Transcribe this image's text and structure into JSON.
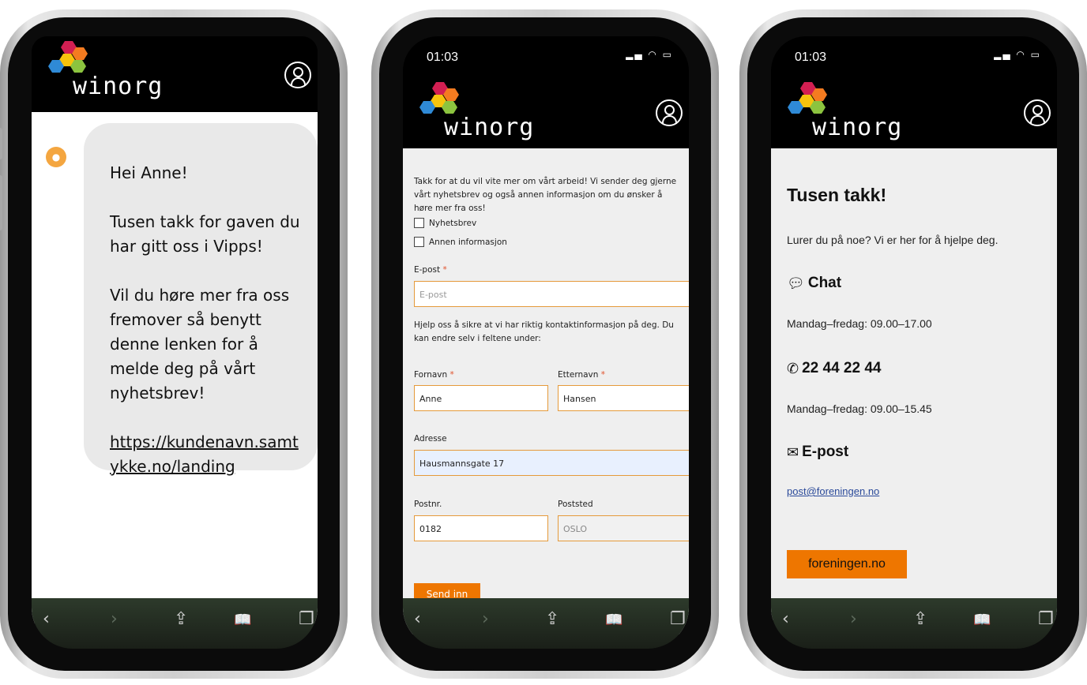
{
  "brand": {
    "logo_text": "winorg"
  },
  "status": {
    "time": "01:03",
    "icons": "▂▄ ◠ ▭"
  },
  "phone1": {
    "greeting": "Hei Anne!",
    "para1": "Tusen takk for gaven du har gitt oss i Vipps!",
    "para2": "Vil du høre mer fra oss fremover så benytt denne lenken for å melde deg på vårt nyhetsbrev!",
    "link": "https://kundenavn.samtykke.no/landing"
  },
  "phone2": {
    "intro": "Takk for at du vil vite mer om vårt arbeid! Vi sender deg gjerne vårt nyhetsbrev og også annen informasjon om du ønsker å høre mer fra oss!",
    "checkbox1": "Nyhetsbrev",
    "checkbox2": "Annen informasjon",
    "email_label": "E-post",
    "email_placeholder": "E-post",
    "help_text": "Hjelp oss å sikre at vi har riktig kontaktinformasjon på deg. Du kan endre selv i feltene under:",
    "firstname_label": "Fornavn",
    "firstname_value": "Anne",
    "lastname_label": "Etternavn",
    "lastname_value": "Hansen",
    "address_label": "Adresse",
    "address_value": "Hausmannsgate 17",
    "postnr_label": "Postnr.",
    "postnr_value": "0182",
    "poststed_label": "Poststed",
    "poststed_value": "OSLO",
    "required_mark": "*",
    "submit_label": "Send inn"
  },
  "phone3": {
    "title": "Tusen takk!",
    "subtitle": "Lurer du på noe? Vi er her for å hjelpe deg.",
    "chat_heading": "Chat",
    "chat_hours": "Mandag–fredag: 09.00–17.00",
    "phone_heading": "22 44 22 44",
    "phone_hours": "Mandag–fredag: 09.00–15.45",
    "email_heading": "E-post",
    "email_link": "post@foreningen.no",
    "website_button": "foreningen.no"
  },
  "toolbar": {
    "back": "‹",
    "forward": "›",
    "share": "⇪",
    "bookmarks": "📖",
    "tabs": "❐"
  },
  "colors": {
    "accent": "#ee7600",
    "field_border": "#e59a3b",
    "link": "#2b4a9a",
    "page_bg": "#efefef"
  }
}
